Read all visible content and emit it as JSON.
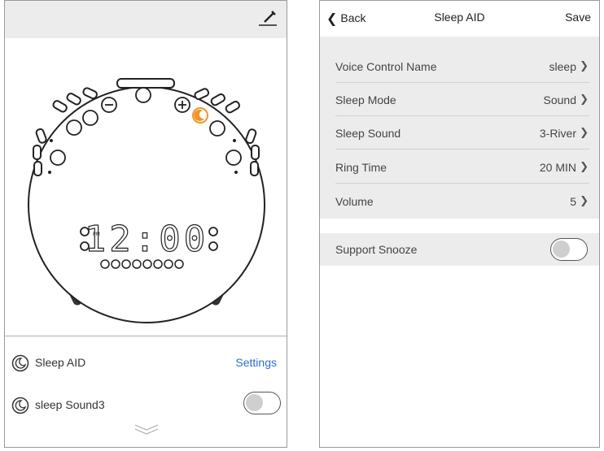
{
  "left_panel": {
    "device": {
      "clock_display": "12:00",
      "pm_label": "PM"
    },
    "rows": {
      "sleep_aid_label": "Sleep AID",
      "settings_label": "Settings",
      "sleep_sound_label": "sleep Sound3"
    },
    "sleep_sound_toggle_on": false
  },
  "right_panel": {
    "nav": {
      "back_label": "Back",
      "title": "Sleep AID",
      "save_label": "Save"
    },
    "settings": [
      {
        "label": "Voice Control Name",
        "value": "sleep"
      },
      {
        "label": "Sleep Mode",
        "value": "Sound"
      },
      {
        "label": "Sleep Sound",
        "value": "3-River"
      },
      {
        "label": "Ring Time",
        "value": "20 MIN"
      },
      {
        "label": "Volume",
        "value": "5"
      }
    ],
    "support_snooze_label": "Support Snooze",
    "support_snooze_on": false
  },
  "colors": {
    "accent_link": "#2a6fcf",
    "highlight_icon": "#f0952a",
    "header_gray": "#ececec"
  }
}
